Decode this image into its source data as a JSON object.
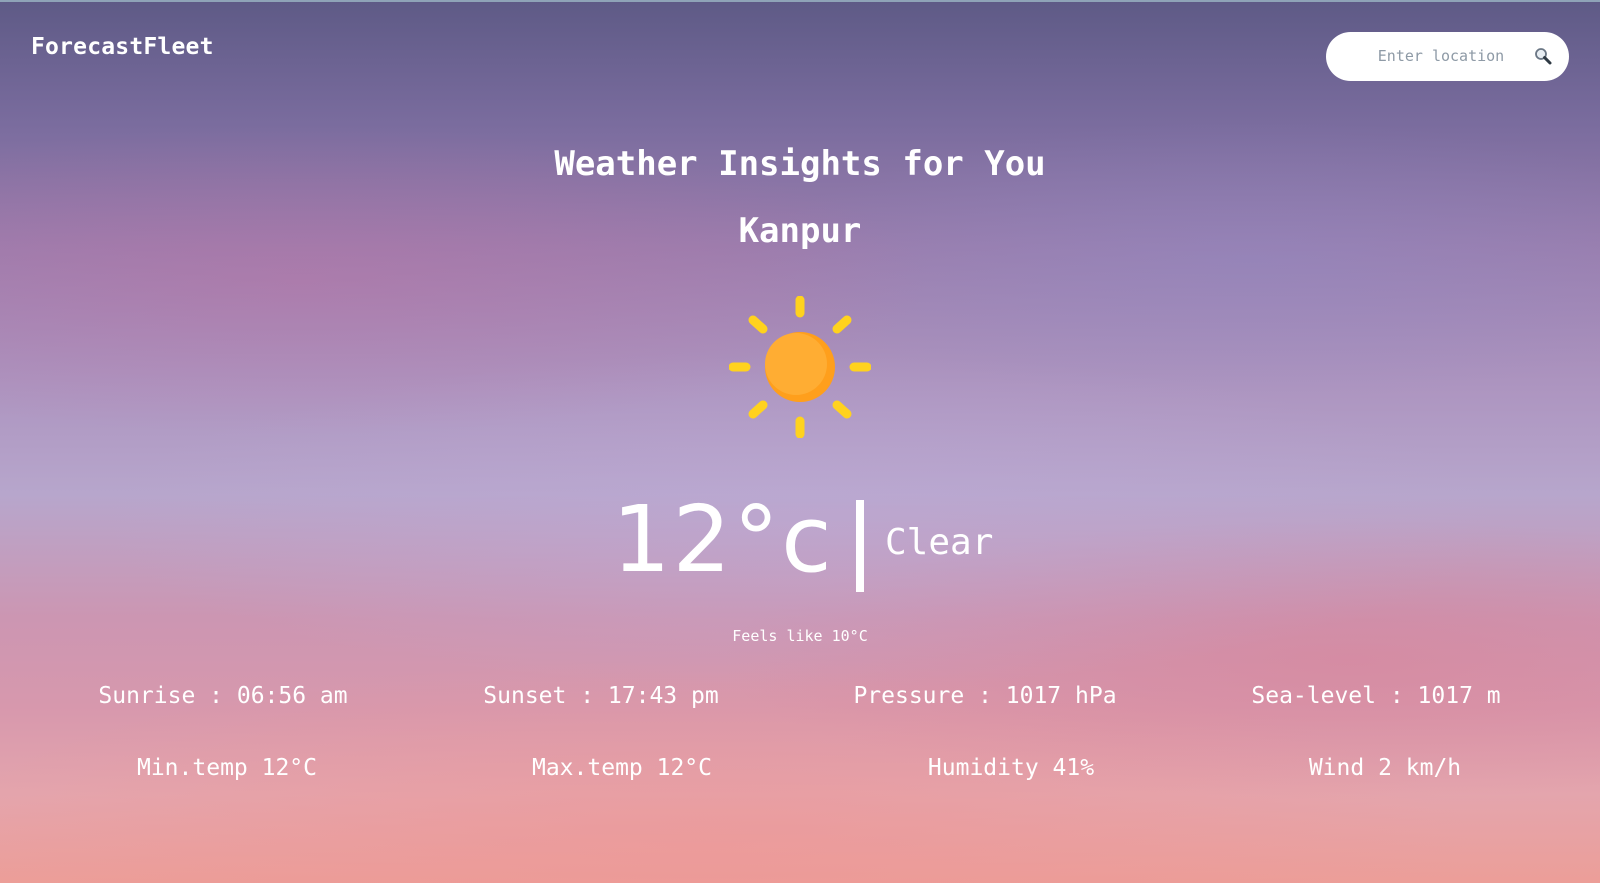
{
  "app": {
    "brand": "ForecastFleet"
  },
  "search": {
    "placeholder": "Enter location",
    "value": ""
  },
  "hero": {
    "headline": "Weather Insights for You",
    "city": "Kanpur",
    "weather_icon": "sun-icon",
    "temperature": "12°c",
    "condition": "Clear",
    "feels_like": "Feels like 10°C"
  },
  "stats_row1": [
    {
      "text": "Sunrise : 06:56 am"
    },
    {
      "text": "Sunset : 17:43 pm"
    },
    {
      "text": "Pressure : 1017 hPa"
    },
    {
      "text": "Sea-level : 1017 m"
    }
  ],
  "stats_row2": [
    {
      "text": "Min.temp 12°C"
    },
    {
      "text": "Max.temp 12°C"
    },
    {
      "text": "Humidity 41%"
    },
    {
      "text": "Wind 2 km/h"
    }
  ],
  "colors": {
    "sun_body": "#ffad33",
    "sun_shade": "#ff9f1c",
    "sun_rays": "#ffd21e",
    "text": "#ffffff"
  }
}
